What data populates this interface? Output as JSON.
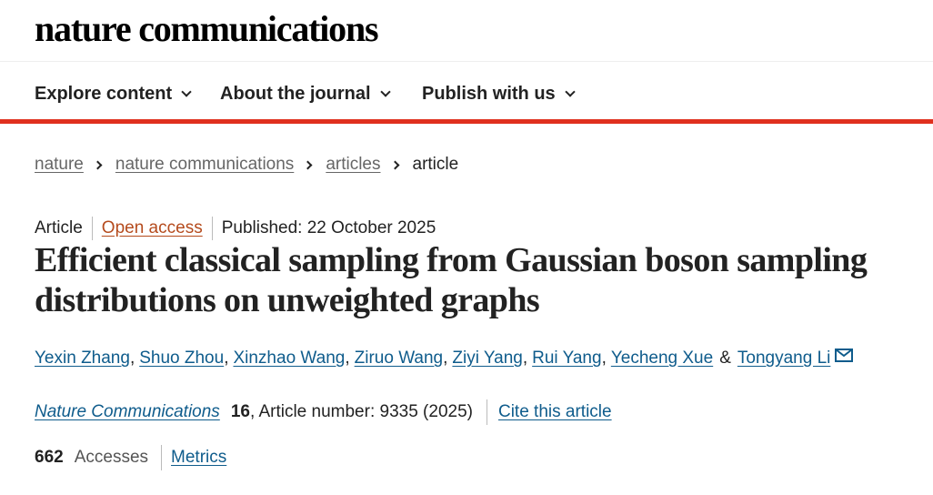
{
  "header": {
    "logo_text": "nature communications"
  },
  "nav": {
    "items": [
      {
        "label": "Explore content",
        "icon": "chevron-down-icon"
      },
      {
        "label": "About the journal",
        "icon": "chevron-down-icon"
      },
      {
        "label": "Publish with us",
        "icon": "chevron-down-icon"
      }
    ],
    "accent_color": "#e0301e"
  },
  "breadcrumb": {
    "items": [
      "nature",
      "nature communications",
      "articles"
    ],
    "current": "article"
  },
  "article": {
    "type": "Article",
    "access": "Open access",
    "published": "Published: 22 October 2025",
    "title": "Efficient classical sampling from Gaussian boson sampling distributions on unweighted graphs",
    "authors": [
      "Yexin Zhang",
      "Shuo Zhou",
      "Xinzhao Wang",
      "Ziruo Wang",
      "Ziyi Yang",
      "Rui Yang",
      "Yecheng Xue",
      "Tongyang Li"
    ],
    "author_separator": ",",
    "author_final_separator": "&",
    "corresponding_icon": "mail-icon",
    "journal": "Nature Communications",
    "volume": "16",
    "article_number": ", Article number: 9335 (2025)",
    "cite_label": "Cite this article",
    "accesses_count": "662",
    "accesses_label": "Accesses",
    "metrics_label": "Metrics"
  },
  "colors": {
    "link": "#0f5c8c",
    "open_access": "#b54b1d",
    "text": "#222222"
  }
}
